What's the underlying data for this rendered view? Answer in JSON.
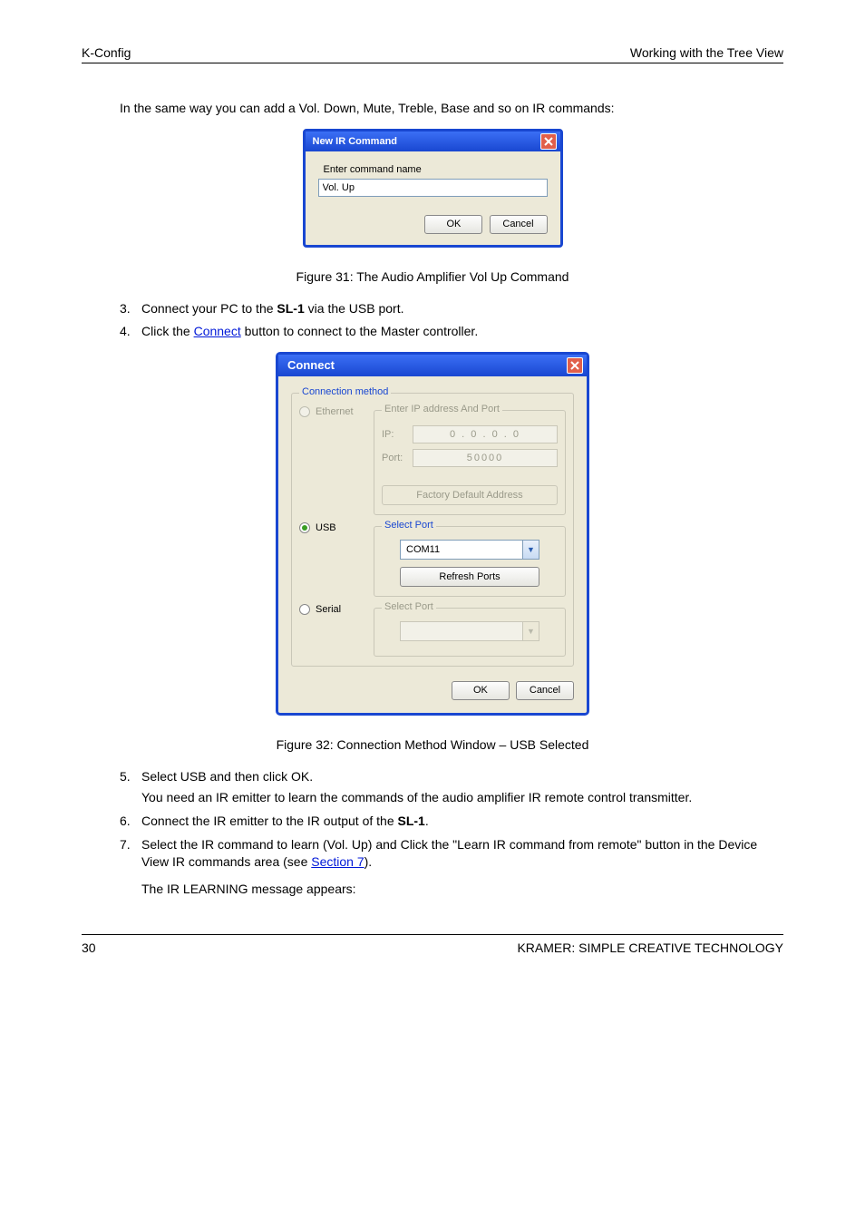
{
  "header": {
    "left": "K-Config",
    "right": "Working with the Tree View"
  },
  "intro": "In the same way you can add a Vol. Down, Mute, Treble, Base and so on IR commands:",
  "dialog1": {
    "title": "New IR Command",
    "label": "Enter command name",
    "value": "Vol. Up",
    "ok": "OK",
    "cancel": "Cancel"
  },
  "fig1_caption": "Figure 31: The Audio Amplifier Vol Up Command",
  "steps": {
    "n3": "3.",
    "t3a": "Connect your PC to the ",
    "t3b_bold": "SL-1",
    "t3c": " via the USB port.",
    "n4": "4.",
    "t4a": "Click the ",
    "t4b_link": "Connect",
    "t4c": " button to connect to the Master controller."
  },
  "dialog2": {
    "title": "Connect",
    "group_legend": "Connection method",
    "ethernet_label": "Ethernet",
    "ip_group_legend": "Enter IP address And Port",
    "ip_label": "IP:",
    "ip_value": "0  .  0  .  0  .  0",
    "port_label": "Port:",
    "port_value": "50000",
    "factory_btn": "Factory Default Address",
    "usb_label": "USB",
    "usb_group_legend": "Select Port",
    "usb_combo": "COM11",
    "refresh_btn": "Refresh Ports",
    "serial_label": "Serial",
    "serial_group_legend": "Select Port",
    "ok": "OK",
    "cancel": "Cancel"
  },
  "fig2_caption": "Figure 32: Connection Method Window – USB Selected",
  "post": {
    "n5": "5.",
    "t5": "Select USB and then click OK.",
    "t5_sub": "You need an IR emitter to learn the commands of the audio amplifier IR remote control transmitter.",
    "n6": "6.",
    "t6a": "Connect the IR emitter to the IR output of the ",
    "t6b_bold": "SL-1",
    "t6c": ".",
    "n7": "7.",
    "t7": "Select the IR command to learn (Vol. Up) and Click the \"Learn IR command from remote\" button in the Device View IR commands area (see ",
    "t7_link": "Section 7",
    "t7_end": ").",
    "p8": "The IR LEARNING message appears:"
  },
  "footer": {
    "left": "30",
    "right": "KRAMER: SIMPLE CREATIVE TECHNOLOGY"
  }
}
